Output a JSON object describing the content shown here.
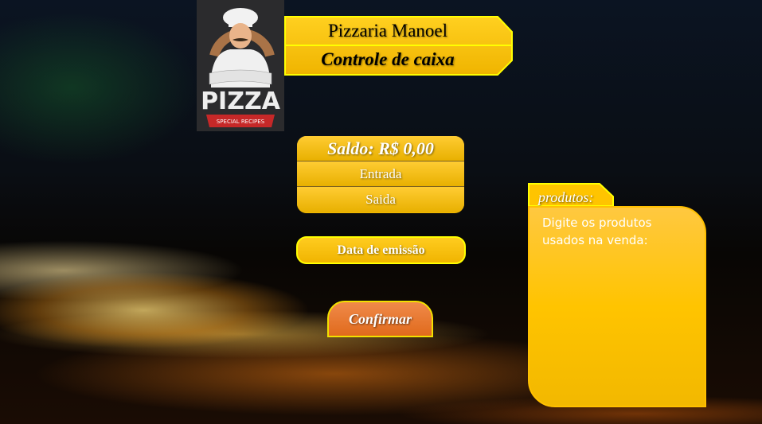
{
  "logo": {
    "title": "PIZZA",
    "subtitle": "SPECIAL RECIPES"
  },
  "header": {
    "title": "Pizzaria Manoel",
    "subtitle": "Controle de caixa"
  },
  "saldo": {
    "label": "Saldo: R$ 0,00",
    "entrada": "Entrada",
    "saida": "Saida"
  },
  "data_emissao": "Data de emissão",
  "confirm": "Confirmar",
  "produtos": {
    "tab": "produtos:",
    "placeholder": "Digite os produtos usados na venda:"
  },
  "colors": {
    "yellow": "#ffc400",
    "border": "#ffff00",
    "orange": "#e8742a"
  }
}
